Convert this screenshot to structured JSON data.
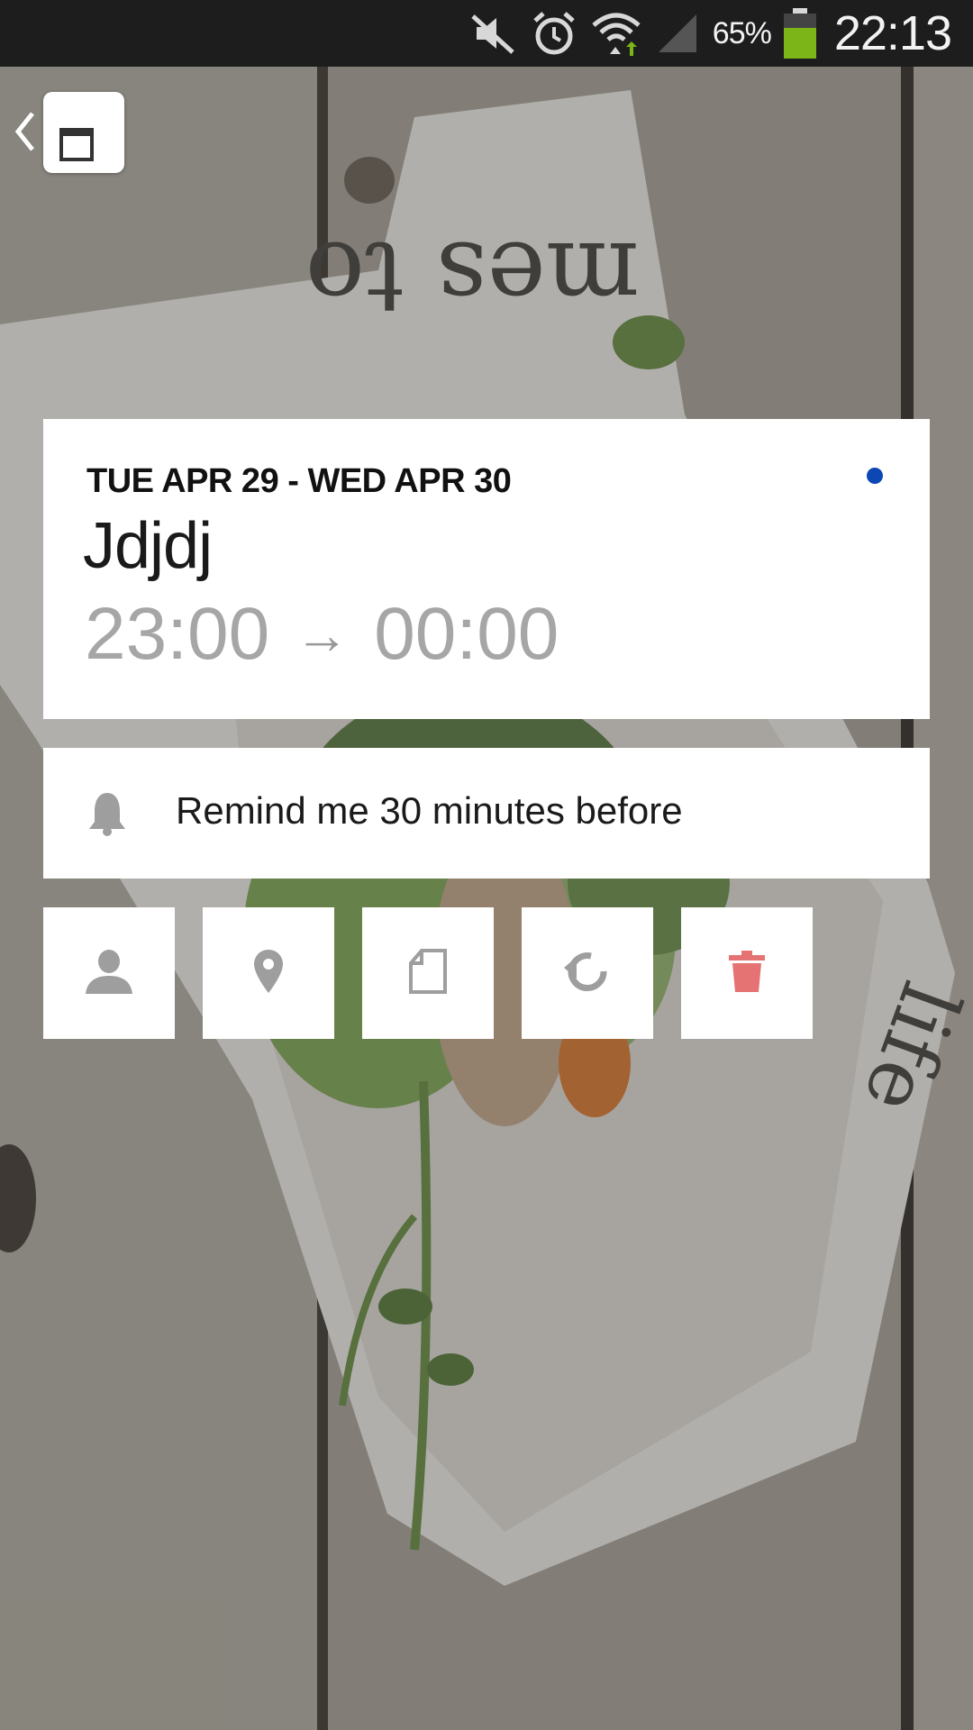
{
  "status_bar": {
    "icons": [
      "mute-icon",
      "alarm-icon",
      "wifi-icon",
      "signal-icon",
      "battery-icon"
    ],
    "battery_percent": "65%",
    "time": "22:13",
    "battery_color": "#7cb518"
  },
  "header": {
    "back_icon": "chevron-left-icon",
    "app_icon": "calendar-app-icon"
  },
  "event": {
    "date_range": "TUE APR 29 - WED APR 30",
    "title": "Jdjdj",
    "start_time": "23:00",
    "arrow": "→",
    "end_time": "00:00",
    "calendar_color": "#0d47b4"
  },
  "reminder": {
    "icon": "bell-icon",
    "text": "Remind me 30 minutes before"
  },
  "actions": [
    {
      "name": "attendees",
      "icon": "person-icon"
    },
    {
      "name": "location",
      "icon": "location-pin-icon"
    },
    {
      "name": "note",
      "icon": "note-icon"
    },
    {
      "name": "repeat",
      "icon": "repeat-icon"
    },
    {
      "name": "delete",
      "icon": "trash-icon",
      "color": "#e57373"
    }
  ]
}
